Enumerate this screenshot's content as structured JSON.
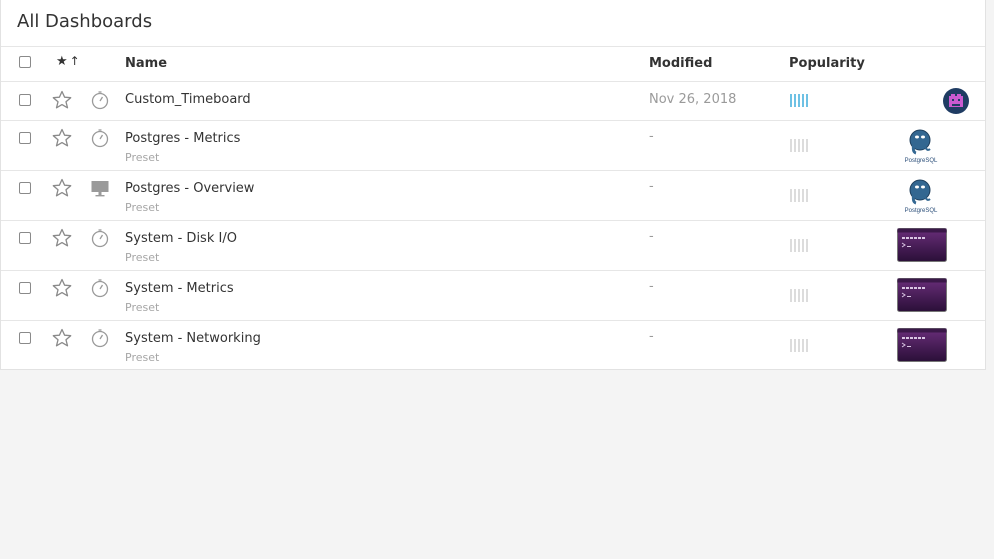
{
  "page": {
    "title": "All Dashboards"
  },
  "columns": {
    "name": "Name",
    "modified": "Modified",
    "popularity": "Popularity"
  },
  "colors": {
    "popularity_active": "#6ec1e4",
    "popularity_inactive": "#dcdcdc"
  },
  "rows": [
    {
      "name": "Custom_Timeboard",
      "subtitle": "",
      "modified": "Nov 26, 2018",
      "popularity_level": 5,
      "type_icon": "stopwatch-icon",
      "logo": "avatar-icon"
    },
    {
      "name": "Postgres - Metrics",
      "subtitle": "Preset",
      "modified": "-",
      "popularity_level": 0,
      "type_icon": "stopwatch-icon",
      "logo": "postgresql-logo"
    },
    {
      "name": "Postgres - Overview",
      "subtitle": "Preset",
      "modified": "-",
      "popularity_level": 0,
      "type_icon": "monitor-icon",
      "logo": "postgresql-logo"
    },
    {
      "name": "System - Disk I/O",
      "subtitle": "Preset",
      "modified": "-",
      "popularity_level": 0,
      "type_icon": "stopwatch-icon",
      "logo": "system-logo"
    },
    {
      "name": "System - Metrics",
      "subtitle": "Preset",
      "modified": "-",
      "popularity_level": 0,
      "type_icon": "stopwatch-icon",
      "logo": "system-logo"
    },
    {
      "name": "System - Networking",
      "subtitle": "Preset",
      "modified": "-",
      "popularity_level": 0,
      "type_icon": "stopwatch-icon",
      "logo": "system-logo"
    }
  ]
}
